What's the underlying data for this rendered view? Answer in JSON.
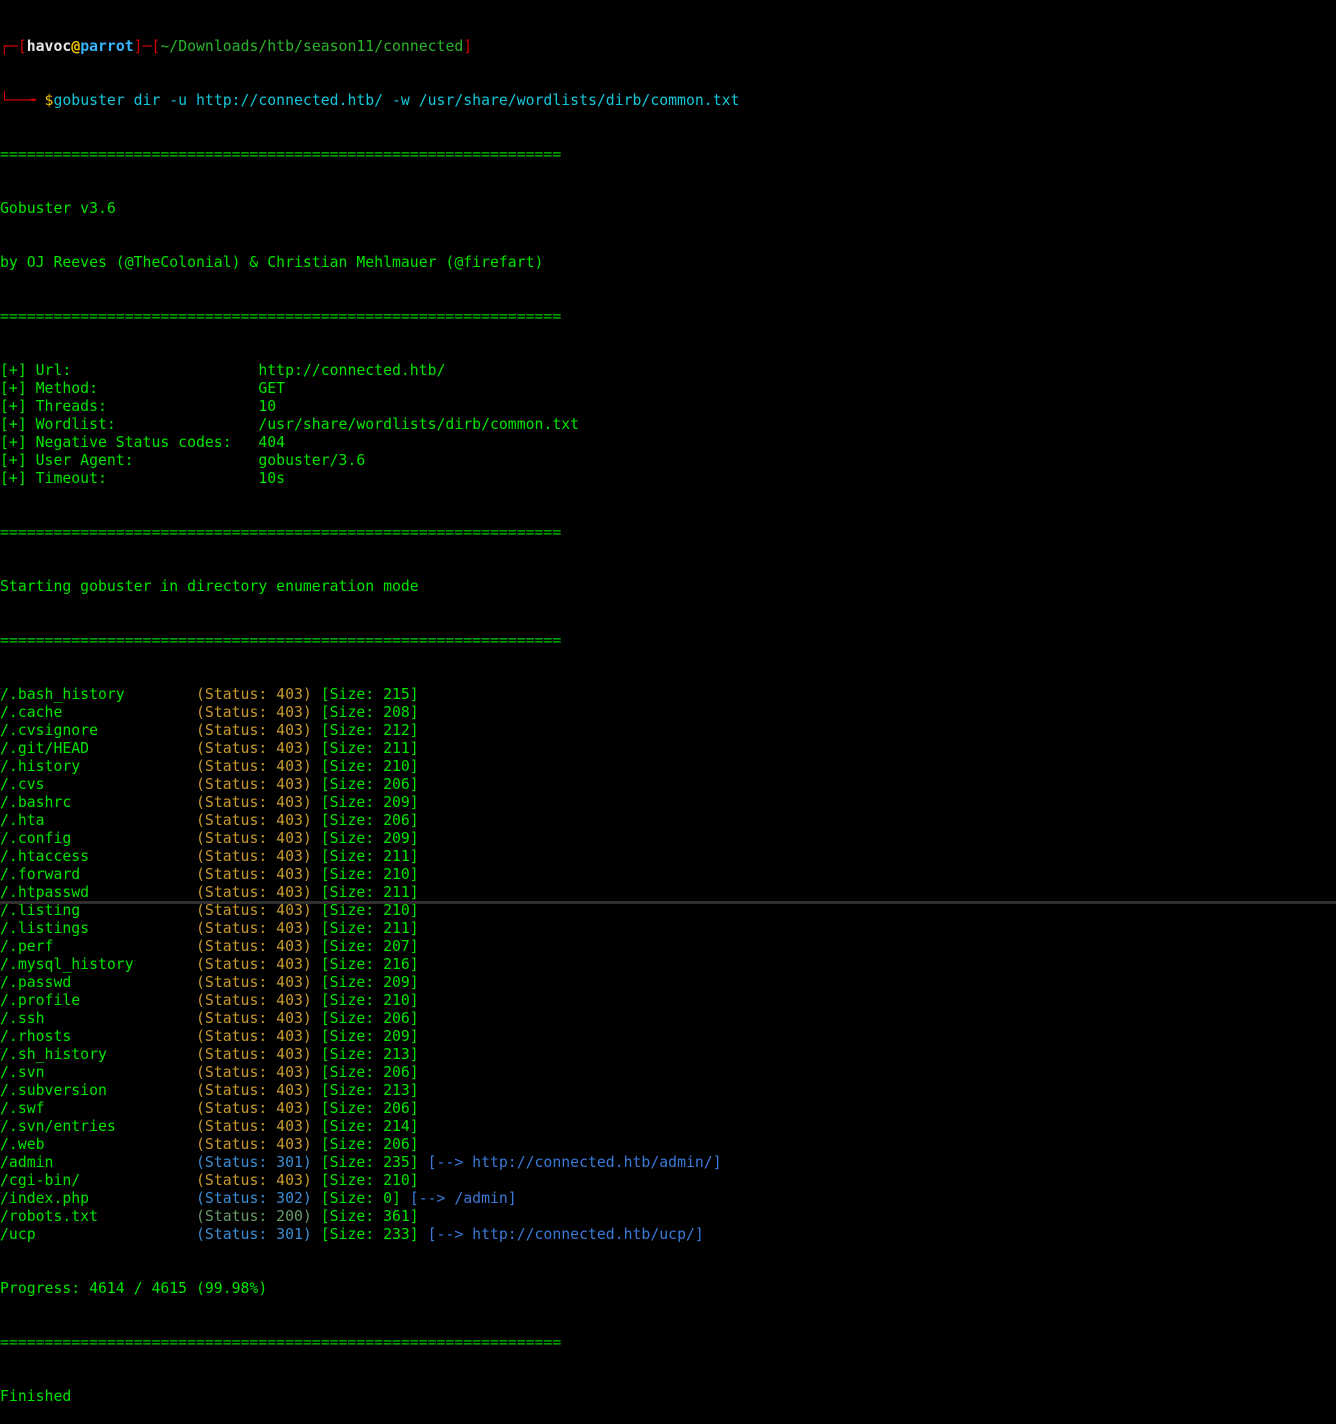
{
  "prompt": {
    "corner_top": "┌─[",
    "user": "havoc",
    "at": "@",
    "host": "parrot",
    "mid": "]─[",
    "cwd": "~/Downloads/htb/season11/connected",
    "close": "]",
    "corner_bottom": "└──╼ ",
    "dollar": "$",
    "command": "gobuster dir -u http://connected.htb/ -w /usr/share/wordlists/dirb/common.txt"
  },
  "separator": "===============================================================",
  "banner": {
    "title": "Gobuster v3.6",
    "authors": "by OJ Reeves (@TheColonial) & Christian Mehlmauer (@firefart)"
  },
  "config": [
    {
      "label": "[+] Url:                     ",
      "value": "http://connected.htb/"
    },
    {
      "label": "[+] Method:                  ",
      "value": "GET"
    },
    {
      "label": "[+] Threads:                 ",
      "value": "10"
    },
    {
      "label": "[+] Wordlist:                ",
      "value": "/usr/share/wordlists/dirb/common.txt"
    },
    {
      "label": "[+] Negative Status codes:   ",
      "value": "404"
    },
    {
      "label": "[+] User Agent:              ",
      "value": "gobuster/3.6"
    },
    {
      "label": "[+] Timeout:                 ",
      "value": "10s"
    }
  ],
  "mode_line": "Starting gobuster in directory enumeration mode",
  "results": [
    {
      "path": "/.bash_history        ",
      "status": "(Status: 403)",
      "size": " [Size: 215]",
      "redirect": "",
      "color": "#c99a2e"
    },
    {
      "path": "/.cache               ",
      "status": "(Status: 403)",
      "size": " [Size: 208]",
      "redirect": "",
      "color": "#c99a2e"
    },
    {
      "path": "/.cvsignore           ",
      "status": "(Status: 403)",
      "size": " [Size: 212]",
      "redirect": "",
      "color": "#c99a2e"
    },
    {
      "path": "/.git/HEAD            ",
      "status": "(Status: 403)",
      "size": " [Size: 211]",
      "redirect": "",
      "color": "#c99a2e"
    },
    {
      "path": "/.history             ",
      "status": "(Status: 403)",
      "size": " [Size: 210]",
      "redirect": "",
      "color": "#c99a2e"
    },
    {
      "path": "/.cvs                 ",
      "status": "(Status: 403)",
      "size": " [Size: 206]",
      "redirect": "",
      "color": "#c99a2e"
    },
    {
      "path": "/.bashrc              ",
      "status": "(Status: 403)",
      "size": " [Size: 209]",
      "redirect": "",
      "color": "#c99a2e"
    },
    {
      "path": "/.hta                 ",
      "status": "(Status: 403)",
      "size": " [Size: 206]",
      "redirect": "",
      "color": "#c99a2e"
    },
    {
      "path": "/.config              ",
      "status": "(Status: 403)",
      "size": " [Size: 209]",
      "redirect": "",
      "color": "#c99a2e"
    },
    {
      "path": "/.htaccess            ",
      "status": "(Status: 403)",
      "size": " [Size: 211]",
      "redirect": "",
      "color": "#c99a2e"
    },
    {
      "path": "/.forward             ",
      "status": "(Status: 403)",
      "size": " [Size: 210]",
      "redirect": "",
      "color": "#c99a2e"
    },
    {
      "path": "/.htpasswd            ",
      "status": "(Status: 403)",
      "size": " [Size: 211]",
      "redirect": "",
      "color": "#c99a2e"
    },
    {
      "path": "/.listing             ",
      "status": "(Status: 403)",
      "size": " [Size: 210]",
      "redirect": "",
      "color": "#c99a2e"
    },
    {
      "path": "/.listings            ",
      "status": "(Status: 403)",
      "size": " [Size: 211]",
      "redirect": "",
      "color": "#c99a2e"
    },
    {
      "path": "/.perf                ",
      "status": "(Status: 403)",
      "size": " [Size: 207]",
      "redirect": "",
      "color": "#c99a2e"
    },
    {
      "path": "/.mysql_history       ",
      "status": "(Status: 403)",
      "size": " [Size: 216]",
      "redirect": "",
      "color": "#c99a2e"
    },
    {
      "path": "/.passwd              ",
      "status": "(Status: 403)",
      "size": " [Size: 209]",
      "redirect": "",
      "color": "#c99a2e"
    },
    {
      "path": "/.profile             ",
      "status": "(Status: 403)",
      "size": " [Size: 210]",
      "redirect": "",
      "color": "#c99a2e"
    },
    {
      "path": "/.ssh                 ",
      "status": "(Status: 403)",
      "size": " [Size: 206]",
      "redirect": "",
      "color": "#c99a2e"
    },
    {
      "path": "/.rhosts              ",
      "status": "(Status: 403)",
      "size": " [Size: 209]",
      "redirect": "",
      "color": "#c99a2e"
    },
    {
      "path": "/.sh_history          ",
      "status": "(Status: 403)",
      "size": " [Size: 213]",
      "redirect": "",
      "color": "#c99a2e"
    },
    {
      "path": "/.svn                 ",
      "status": "(Status: 403)",
      "size": " [Size: 206]",
      "redirect": "",
      "color": "#c99a2e"
    },
    {
      "path": "/.subversion          ",
      "status": "(Status: 403)",
      "size": " [Size: 213]",
      "redirect": "",
      "color": "#c99a2e"
    },
    {
      "path": "/.swf                 ",
      "status": "(Status: 403)",
      "size": " [Size: 206]",
      "redirect": "",
      "color": "#c99a2e"
    },
    {
      "path": "/.svn/entries         ",
      "status": "(Status: 403)",
      "size": " [Size: 214]",
      "redirect": "",
      "color": "#c99a2e"
    },
    {
      "path": "/.web                 ",
      "status": "(Status: 403)",
      "size": " [Size: 206]",
      "redirect": "",
      "color": "#c99a2e"
    },
    {
      "path": "/admin                ",
      "status": "(Status: 301)",
      "size": " [Size: 235]",
      "redirect": " [--> http://connected.htb/admin/]",
      "color": "#3b8ed4"
    },
    {
      "path": "/cgi-bin/             ",
      "status": "(Status: 403)",
      "size": " [Size: 210]",
      "redirect": "",
      "color": "#c99a2e"
    },
    {
      "path": "/index.php            ",
      "status": "(Status: 302)",
      "size": " [Size: 0]",
      "redirect": " [--> /admin]",
      "color": "#3b8ed4"
    },
    {
      "path": "/robots.txt           ",
      "status": "(Status: 200)",
      "size": " [Size: 361]",
      "redirect": "",
      "color": "#6a9a6a"
    },
    {
      "path": "/ucp                  ",
      "status": "(Status: 301)",
      "size": " [Size: 233]",
      "redirect": " [--> http://connected.htb/ucp/]",
      "color": "#3b8ed4"
    }
  ],
  "progress": "Progress: 4614 / 4615 (99.98%)",
  "finished": "Finished"
}
